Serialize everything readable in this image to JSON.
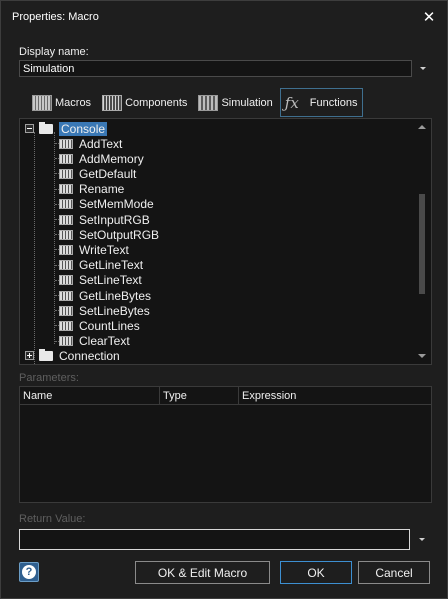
{
  "window": {
    "title": "Properties: Macro"
  },
  "display_name": {
    "label": "Display name:",
    "value": "Simulation"
  },
  "tabs": [
    {
      "label": "Macros",
      "icon": "macros-icon"
    },
    {
      "label": "Components",
      "icon": "components-icon"
    },
    {
      "label": "Simulation",
      "icon": "simulation-icon"
    },
    {
      "label": "Functions",
      "icon": "fx-icon",
      "active": true
    }
  ],
  "tree": {
    "root": {
      "label": "Console",
      "selected": true,
      "expanded": true
    },
    "children": [
      "AddText",
      "AddMemory",
      "GetDefault",
      "Rename",
      "SetMemMode",
      "SetInputRGB",
      "SetOutputRGB",
      "WriteText",
      "GetLineText",
      "SetLineText",
      "GetLineBytes",
      "SetLineBytes",
      "CountLines",
      "ClearText"
    ],
    "next_root": {
      "label": "Connection",
      "expanded": false
    }
  },
  "parameters": {
    "label": "Parameters:",
    "columns": [
      "Name",
      "Type",
      "Expression"
    ]
  },
  "return_value": {
    "label": "Return Value:",
    "value": ""
  },
  "buttons": {
    "ok_edit": "OK & Edit Macro",
    "ok": "OK",
    "cancel": "Cancel"
  },
  "colors": {
    "selection": "#3a78b5",
    "accent_border": "#3d8fd1"
  }
}
